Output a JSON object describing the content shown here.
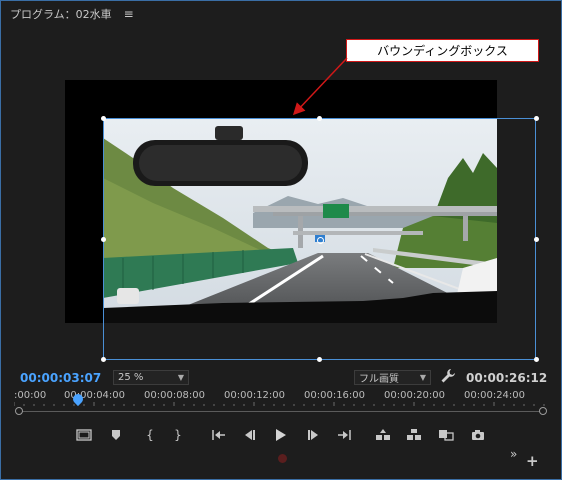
{
  "panel": {
    "title": "プログラム：02水車",
    "menu_icon": "hamburger-menu-icon"
  },
  "callout": {
    "text": "バウンディングボックス",
    "border_color": "#d01818"
  },
  "playback": {
    "current_timecode": "00:00:03:07",
    "total_timecode": "00:00:26:12",
    "current_color": "#4aa3ff"
  },
  "zoom": {
    "selected": "25 %"
  },
  "quality": {
    "selected": "フル画質"
  },
  "ruler": {
    "labels": [
      ":00:00",
      "00:00:04:00",
      "00:00:08:00",
      "00:00:12:00",
      "00:00:16:00",
      "00:00:20:00",
      "00:00:24:00"
    ]
  },
  "controls": [
    {
      "name": "safe-margins-icon"
    },
    {
      "name": "marker-icon"
    },
    {
      "name": "mark-in-icon"
    },
    {
      "name": "mark-out-icon"
    },
    {
      "name": "go-to-in-icon"
    },
    {
      "name": "step-back-icon"
    },
    {
      "name": "play-icon"
    },
    {
      "name": "step-forward-icon"
    },
    {
      "name": "go-to-out-icon"
    },
    {
      "name": "lift-icon"
    },
    {
      "name": "extract-icon"
    },
    {
      "name": "compare-view-icon"
    },
    {
      "name": "export-frame-icon"
    }
  ],
  "footer": {
    "more": "»",
    "add": "+"
  },
  "colors": {
    "accent": "#4aa3ff",
    "bounding_box": "#4a8fd6",
    "background": "#1d1d1d"
  }
}
